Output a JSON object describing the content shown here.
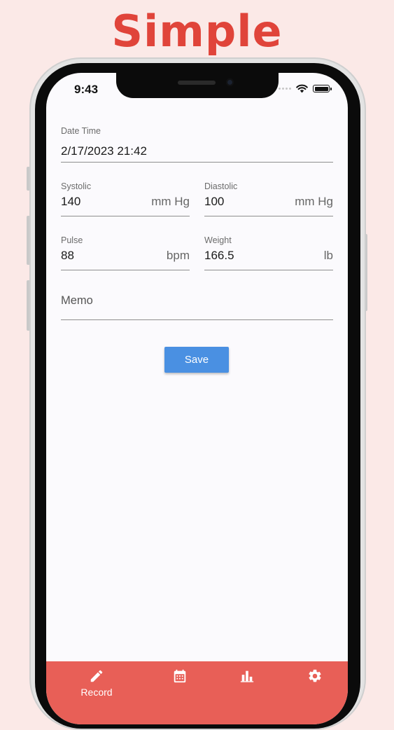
{
  "headline": "Simple",
  "status_bar": {
    "time": "9:43"
  },
  "form": {
    "datetime": {
      "label": "Date Time",
      "value": "2/17/2023 21:42"
    },
    "systolic": {
      "label": "Systolic",
      "value": "140",
      "unit": "mm Hg"
    },
    "diastolic": {
      "label": "Diastolic",
      "value": "100",
      "unit": "mm Hg"
    },
    "pulse": {
      "label": "Pulse",
      "value": "88",
      "unit": "bpm"
    },
    "weight": {
      "label": "Weight",
      "value": "166.5",
      "unit": "lb"
    },
    "memo": {
      "placeholder": "Memo"
    },
    "save_label": "Save"
  },
  "bottom_nav": {
    "items": [
      {
        "label": "Record",
        "icon": "pencil-icon",
        "active": true
      },
      {
        "label": "",
        "icon": "calendar-icon"
      },
      {
        "label": "",
        "icon": "bar-chart-icon"
      },
      {
        "label": "",
        "icon": "gear-icon"
      }
    ]
  },
  "colors": {
    "accent": "#e85f57",
    "headline": "#e0443a",
    "button": "#4a90e2",
    "background": "#fbe9e7"
  }
}
